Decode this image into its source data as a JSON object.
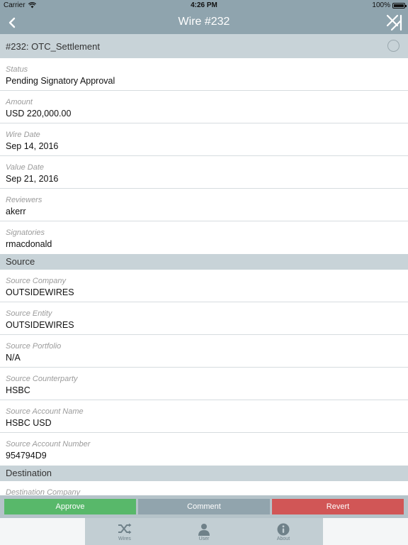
{
  "status_bar": {
    "carrier": "Carrier",
    "time": "4:26 PM",
    "battery": "100%"
  },
  "nav": {
    "title": "Wire #232",
    "back_icon": "chevron-left-icon",
    "close_icon": "close-x-icon"
  },
  "wire_header": {
    "title": "#232: OTC_Settlement"
  },
  "fields": [
    {
      "label": "Status",
      "value": "Pending Signatory Approval"
    },
    {
      "label": "Amount",
      "value": "USD 220,000.00"
    },
    {
      "label": "Wire Date",
      "value": "Sep 14, 2016"
    },
    {
      "label": "Value Date",
      "value": "Sep 21, 2016"
    },
    {
      "label": "Reviewers",
      "value": "akerr"
    },
    {
      "label": "Signatories",
      "value": "rmacdonald"
    }
  ],
  "source": {
    "title": "Source",
    "fields": [
      {
        "label": "Source Company",
        "value": "OUTSIDEWIRES"
      },
      {
        "label": "Source Entity",
        "value": "OUTSIDEWIRES"
      },
      {
        "label": "Source Portfolio",
        "value": "N/A"
      },
      {
        "label": "Source Counterparty",
        "value": "HSBC"
      },
      {
        "label": "Source Account Name",
        "value": "HSBC USD"
      },
      {
        "label": "Source Account Number",
        "value": "954794D9"
      }
    ]
  },
  "destination": {
    "title": "Destination",
    "fields": [
      {
        "label": "Destination Company",
        "value": ""
      }
    ]
  },
  "actions": {
    "approve": "Approve",
    "comment": "Comment",
    "revert": "Revert"
  },
  "colors": {
    "nav": "#8fa4ae",
    "approve": "#58b86a",
    "comment": "#91a4ad",
    "revert": "#d15656"
  },
  "tabs": [
    {
      "label": "Wires",
      "icon": "shuffle-icon"
    },
    {
      "label": "User",
      "icon": "user-icon"
    },
    {
      "label": "About",
      "icon": "info-icon"
    }
  ]
}
